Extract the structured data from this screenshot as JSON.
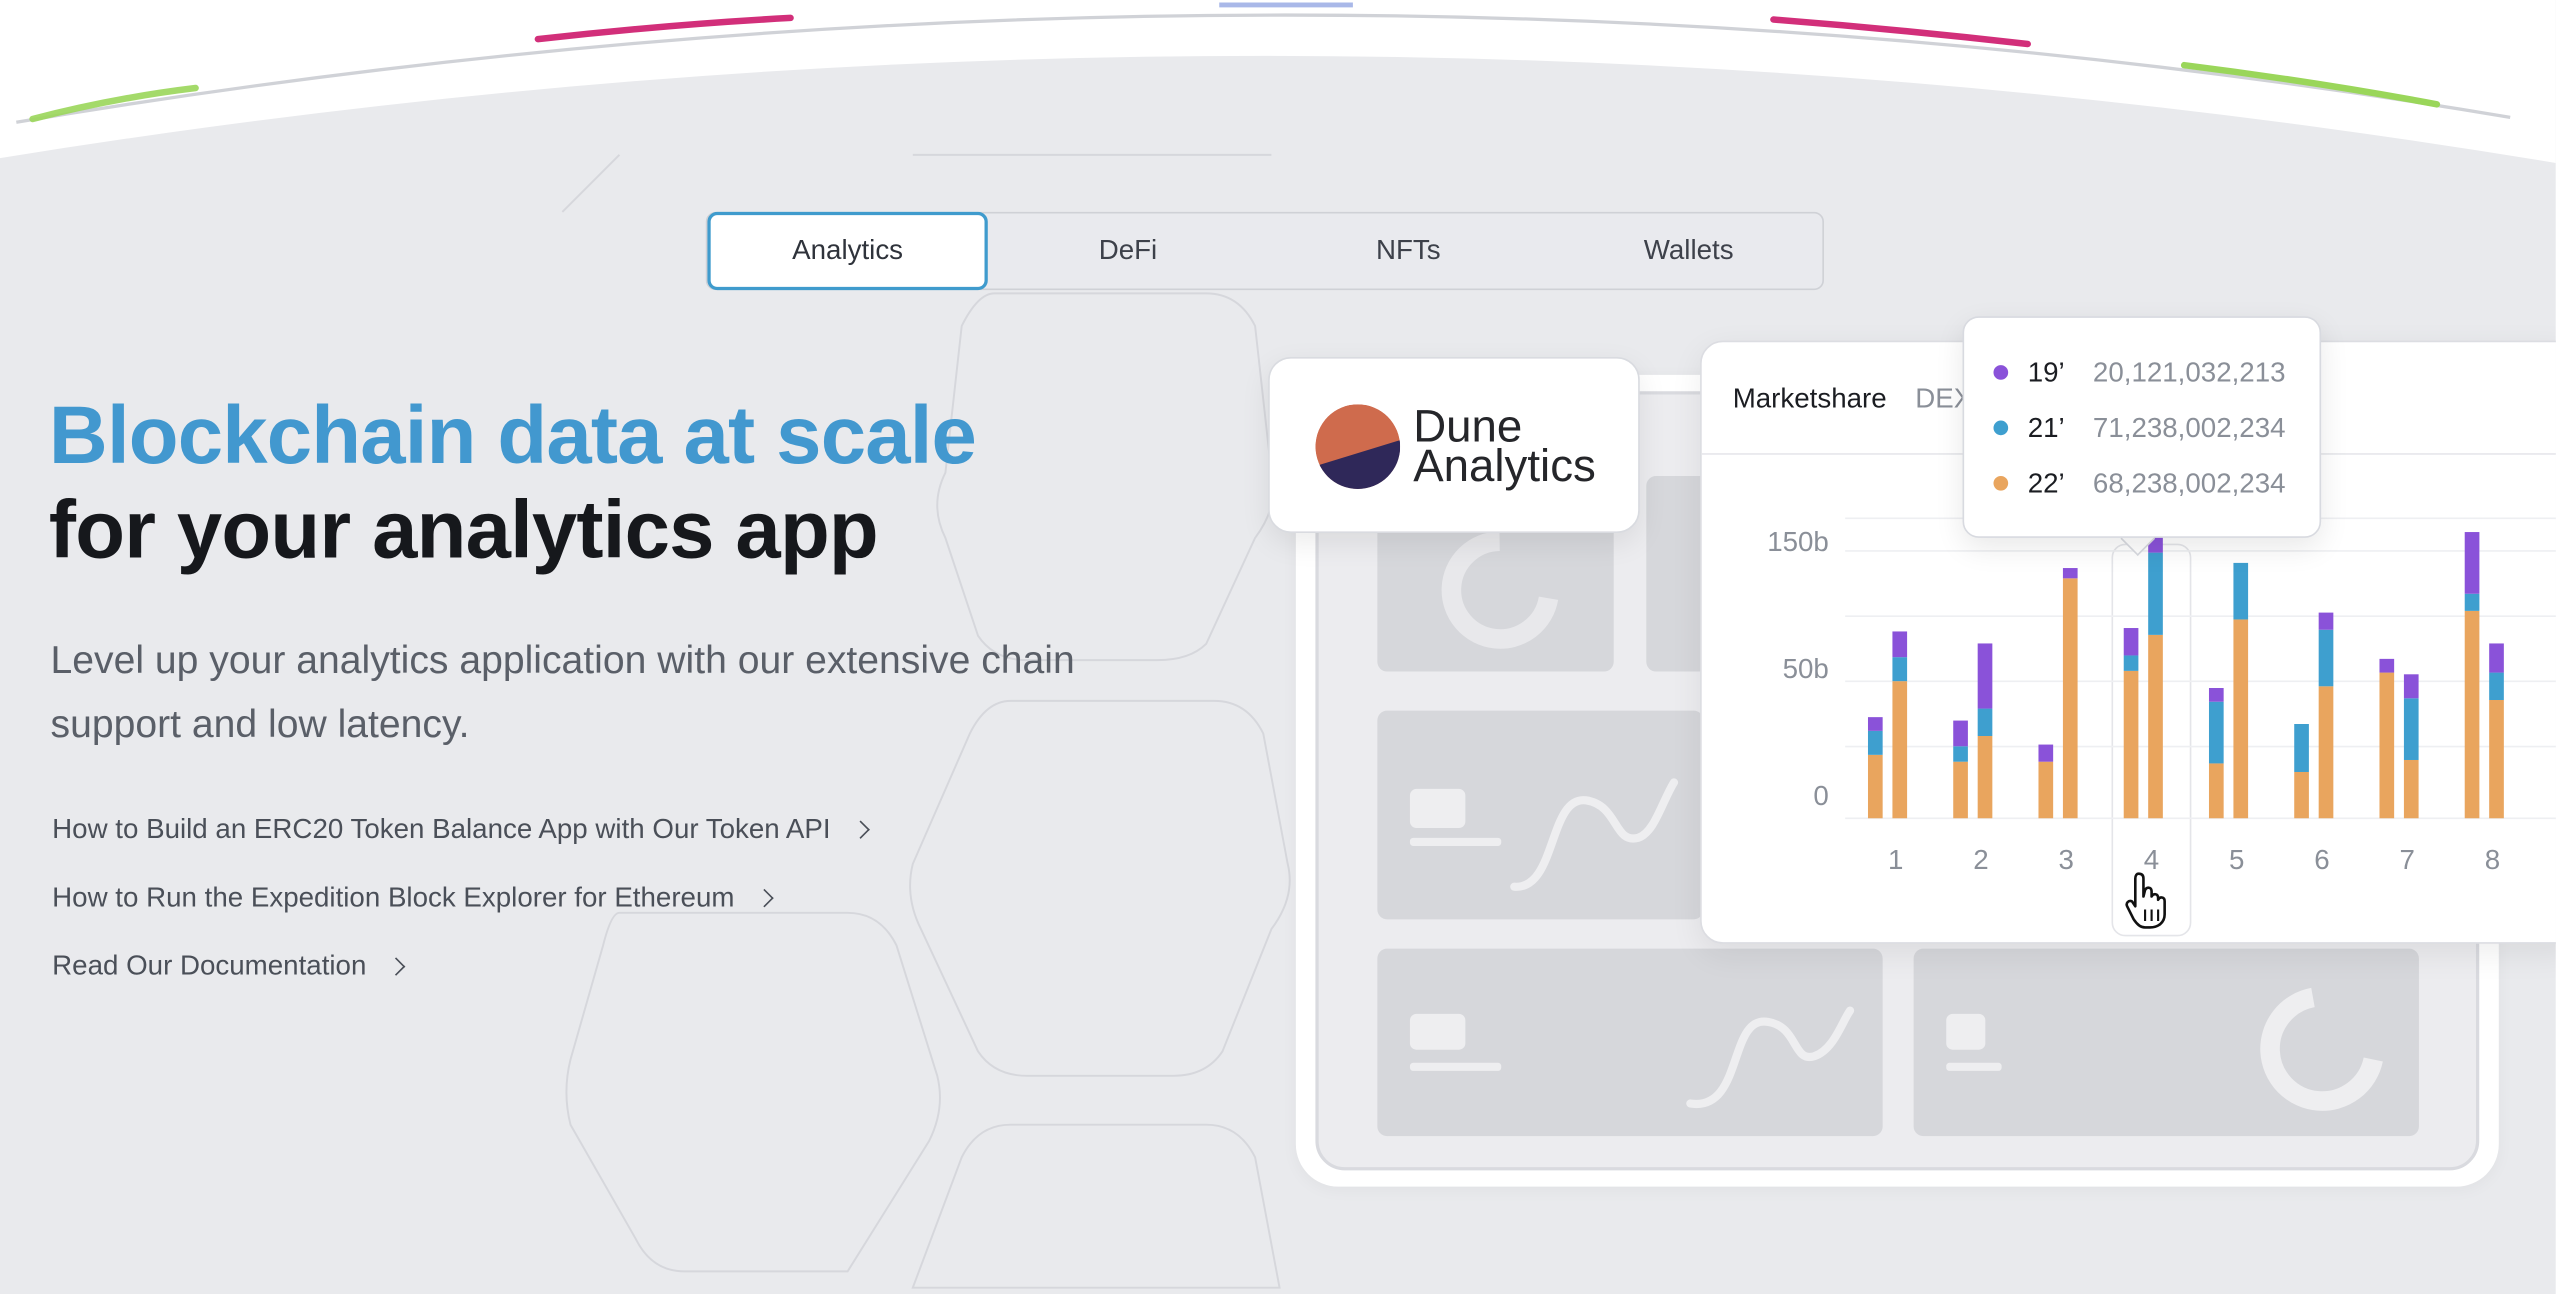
{
  "tabs": [
    {
      "label": "Analytics",
      "active": true
    },
    {
      "label": "DeFi",
      "active": false
    },
    {
      "label": "NFTs",
      "active": false
    },
    {
      "label": "Wallets",
      "active": false
    }
  ],
  "hero": {
    "title_line1": "Blockchain data at scale",
    "title_line2": "for your analytics app",
    "lead": "Level up your analytics application with our extensive chain support and low latency.",
    "links": [
      "How to Build an ERC20 Token Balance App with Our Token API",
      "How to Run the Expedition Block Explorer for Ethereum",
      "Read Our Documentation"
    ]
  },
  "dune_card": {
    "line1": "Dune",
    "line2": "Analytics",
    "logo_colors": {
      "top": "#cf6b4d",
      "bottom": "#2f2859"
    }
  },
  "chart_card": {
    "title": "Marketshare",
    "subtitle": "DEX"
  },
  "tooltip": {
    "rows": [
      {
        "year": "19’",
        "value": "20,121,032,213",
        "color": "#8a52d9"
      },
      {
        "year": "21’",
        "value": "71,238,002,234",
        "color": "#3e9fcf"
      },
      {
        "year": "22’",
        "value": "68,238,002,234",
        "color": "#e9a55e"
      }
    ]
  },
  "chart_data": {
    "type": "bar",
    "stacked": true,
    "categories": [
      "1",
      "2",
      "3",
      "4",
      "5",
      "6",
      "7",
      "8"
    ],
    "y_tick_labels": [
      "150b",
      "50b",
      "0"
    ],
    "highlighted_category": "4",
    "series_colors": {
      "19’": "#8a52d9",
      "21’": "#3e9fcf",
      "22’": "#e9a55e"
    },
    "groups": [
      [
        {
          "22’": 37,
          "21’": 14,
          "19’": 8
        },
        {
          "22’": 80,
          "21’": 14,
          "19’": 15
        }
      ],
      [
        {
          "22’": 33,
          "21’": 9,
          "19’": 15
        },
        {
          "22’": 48,
          "21’": 16,
          "19’": 38
        }
      ],
      [
        {
          "22’": 33,
          "21’": 0,
          "19’": 10
        },
        {
          "22’": 140,
          "21’": 0,
          "19’": 6
        }
      ],
      [
        {
          "22’": 86,
          "21’": 9,
          "19’": 16
        },
        {
          "22’": 107,
          "21’": 48,
          "19’": 15
        }
      ],
      [
        {
          "22’": 32,
          "21’": 36,
          "19’": 8
        },
        {
          "22’": 116,
          "21’": 33,
          "19’": 0
        }
      ],
      [
        {
          "22’": 27,
          "21’": 28,
          "19’": 0
        },
        {
          "22’": 77,
          "21’": 33,
          "19’": 10
        }
      ],
      [
        {
          "22’": 85,
          "21’": 0,
          "19’": 8
        },
        {
          "22’": 34,
          "21’": 36,
          "19’": 14
        }
      ],
      [
        {
          "22’": 121,
          "21’": 10,
          "19’": 36
        },
        {
          "22’": 69,
          "21’": 16,
          "19’": 17
        }
      ]
    ],
    "ylim": [
      0,
      175
    ]
  }
}
